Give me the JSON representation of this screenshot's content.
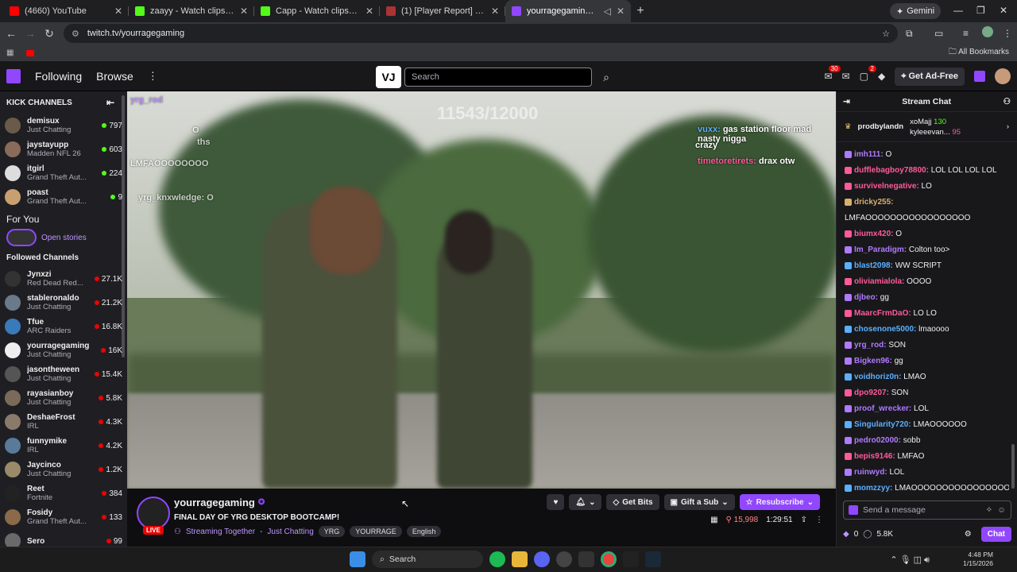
{
  "browser": {
    "tabs": [
      {
        "title": "(4660) YouTube",
        "color": "#ff0000"
      },
      {
        "title": "zaayy - Watch clips on Kick",
        "color": "#53fc18"
      },
      {
        "title": "Capp - Watch clips on Kick",
        "color": "#53fc18"
      },
      {
        "title": "(1) [Player Report] CallUpJefe |",
        "color": "#a33"
      },
      {
        "title": "yourragegaming - Twitch",
        "color": "#9147ff"
      }
    ],
    "gemini_label": "Gemini",
    "url": "twitch.tv/yourragegaming",
    "bookmarks_label": "All Bookmarks"
  },
  "twitch_top": {
    "nav": [
      "Following",
      "Browse"
    ],
    "search_placeholder": "Search",
    "search_logo": "VJ",
    "inbox_badge": "30",
    "notif_badge": "2",
    "ad_free_label": "Get Ad-Free"
  },
  "sidebar": {
    "kick_heading": "KICK CHANNELS",
    "kick_channels": [
      {
        "name": "demisux",
        "category": "Just Chatting",
        "viewers": "797",
        "dot": "#53fc18",
        "avatar": "#6a5a4a"
      },
      {
        "name": "jaystayupp",
        "category": "Madden NFL 26",
        "viewers": "603",
        "dot": "#53fc18",
        "avatar": "#8a6a5a"
      },
      {
        "name": "itgirl",
        "category": "Grand Theft Aut...",
        "viewers": "224",
        "dot": "#53fc18",
        "avatar": "#ddd"
      },
      {
        "name": "poast",
        "category": "Grand Theft Aut...",
        "viewers": "9",
        "dot": "#53fc18",
        "avatar": "#c8a070"
      }
    ],
    "for_you": "For You",
    "open_stories": "Open stories",
    "followed_heading": "Followed Channels",
    "followed": [
      {
        "name": "Jynxzi",
        "category": "Red Dead Red...",
        "viewers": "27.1K",
        "avatar": "#333"
      },
      {
        "name": "stableronaldo",
        "category": "Just Chatting",
        "viewers": "21.2K",
        "avatar": "#6a7a8a"
      },
      {
        "name": "Tfue",
        "category": "ARC Raiders",
        "viewers": "16.8K",
        "avatar": "#3a7aba"
      },
      {
        "name": "yourragegaming",
        "category": "Just Chatting",
        "viewers": "16K",
        "avatar": "#eee"
      },
      {
        "name": "jasontheween",
        "category": "Just Chatting",
        "viewers": "15.4K",
        "avatar": "#555"
      },
      {
        "name": "rayasianboy",
        "category": "Just Chatting",
        "viewers": "5.8K",
        "avatar": "#7a6a5a"
      },
      {
        "name": "DeshaeFrost",
        "category": "IRL",
        "viewers": "4.3K",
        "avatar": "#8a7a6a"
      },
      {
        "name": "funnymike",
        "category": "IRL",
        "viewers": "4.2K",
        "avatar": "#5a7a9a"
      },
      {
        "name": "Jaycinco",
        "category": "Just Chatting",
        "viewers": "1.2K",
        "avatar": "#9a8a6a"
      },
      {
        "name": "Reet",
        "category": "Fortnite",
        "viewers": "384",
        "avatar": "#222"
      },
      {
        "name": "Fosidy",
        "category": "Grand Theft Aut...",
        "viewers": "133",
        "avatar": "#8a6a4a"
      },
      {
        "name": "Sero",
        "category": "",
        "viewers": "99",
        "avatar": "#6a6a6a"
      }
    ]
  },
  "player": {
    "overlay_count": "11543/12000",
    "overlay_chat_right": [
      {
        "user": "vuxx:",
        "text": "gas station floor mad nasty nigga"
      },
      {
        "user": "",
        "text": "crazy"
      },
      {
        "user": "timetoretirets:",
        "text": "drax otw"
      }
    ],
    "overlay_chat_left": [
      "yrg_rod",
      "O",
      "ths",
      "LMFAOOOOOOOO",
      "yrg_knxwledge: O"
    ]
  },
  "stream": {
    "channel": "yourragegaming",
    "live": "LIVE",
    "title": "FINAL DAY OF YRG DESKTOP BOOTCAMP!",
    "together": "Streaming Together",
    "category": "Just Chatting",
    "tags": [
      "YRG",
      "YOURRAGE",
      "English"
    ],
    "get_bits": "Get Bits",
    "gift_sub": "Gift a Sub",
    "resubscribe": "Resubscribe",
    "viewers": "15,998",
    "uptime": "1:29:51"
  },
  "chat": {
    "heading": "Stream Chat",
    "leaderboard": [
      {
        "name": "prodbylandn",
        "value": ""
      },
      {
        "name": "xoMajj",
        "value": "130"
      },
      {
        "name": "kyleeevan...",
        "value": "95"
      }
    ],
    "messages": [
      {
        "user": "imh111:",
        "text": "O",
        "color": "#b07aff"
      },
      {
        "user": "dufflebagboy78800:",
        "text": "LOL LOL LOL LOL",
        "color": "#ff5a9a"
      },
      {
        "user": "survivelnegative:",
        "text": "LO",
        "color": "#ff5a9a"
      },
      {
        "user": "dricky255:",
        "text": "",
        "color": "#d8b06a"
      },
      {
        "user": "",
        "text": "LMFAOOOOOOOOOOOOOOOOO",
        "color": "#efeff1"
      },
      {
        "user": "biumx420:",
        "text": "O",
        "color": "#ff5a9a"
      },
      {
        "user": "Im_Paradigm:",
        "text": "Colton too>",
        "color": "#b07aff"
      },
      {
        "user": "blast2098:",
        "text": "WW SCRIPT",
        "color": "#5ab0ff"
      },
      {
        "user": "oliviamialola:",
        "text": "OOOO",
        "color": "#ff5a9a"
      },
      {
        "user": "djbeo:",
        "text": "gg",
        "color": "#b07aff"
      },
      {
        "user": "MaarcFrmDaO:",
        "text": "LO LO",
        "color": "#ff5a9a"
      },
      {
        "user": "chosenone5000:",
        "text": "lmaoooo",
        "color": "#5ab0ff"
      },
      {
        "user": "yrg_rod:",
        "text": "SON",
        "color": "#b07aff"
      },
      {
        "user": "Bigken96:",
        "text": "gg",
        "color": "#b07aff"
      },
      {
        "user": "voidhoriz0n:",
        "text": "LMAO",
        "color": "#5ab0ff"
      },
      {
        "user": "dpo9207:",
        "text": "SON",
        "color": "#ff5a9a"
      },
      {
        "user": "proof_wrecker:",
        "text": "LOL",
        "color": "#b07aff"
      },
      {
        "user": "Singularity720:",
        "text": "LMAOOOOOO",
        "color": "#5ab0ff"
      },
      {
        "user": "pedro02000:",
        "text": "sobb",
        "color": "#b07aff"
      },
      {
        "user": "bepis9146:",
        "text": "LMFAO",
        "color": "#ff5a9a"
      },
      {
        "user": "ruinwyd:",
        "text": "LOL",
        "color": "#b07aff"
      },
      {
        "user": "momzzyy:",
        "text": "LMAOOOOOOOOOOOOOOOO",
        "color": "#5ab0ff"
      }
    ],
    "placeholder": "Send a message",
    "points_left": "0",
    "points": "5.8K",
    "chat_button": "Chat"
  },
  "taskbar": {
    "search": "Search",
    "time": "4:48 PM",
    "date": "1/15/2026"
  }
}
